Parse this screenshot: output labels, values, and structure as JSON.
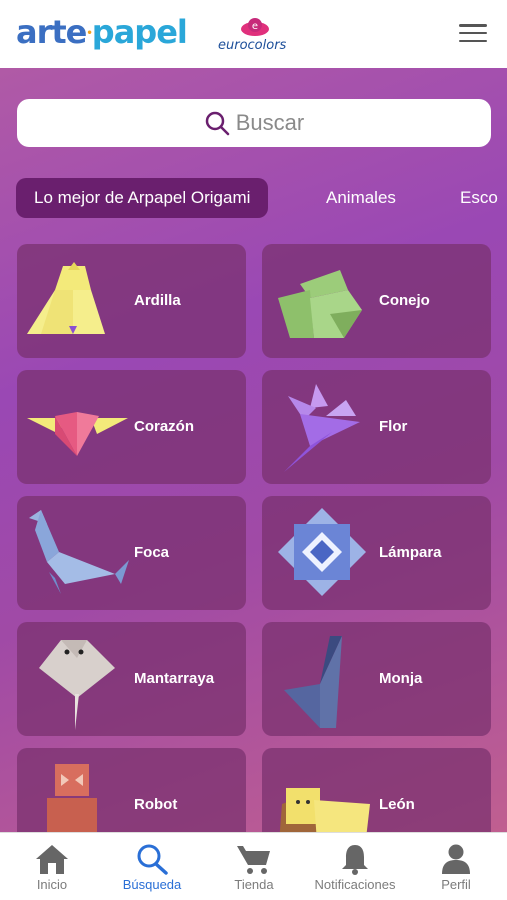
{
  "header": {
    "logo_parts": [
      "arte",
      "papel"
    ],
    "logo_dot": "•",
    "partner_logo": "eurocolors"
  },
  "search": {
    "placeholder": "Buscar"
  },
  "tabs": [
    {
      "label": "Lo mejor de Arpapel Origami",
      "active": true
    },
    {
      "label": "Animales",
      "active": false
    },
    {
      "label": "Esco",
      "active": false
    }
  ],
  "items": [
    {
      "label": "Ardilla"
    },
    {
      "label": "Conejo"
    },
    {
      "label": "Corazón"
    },
    {
      "label": "Flor"
    },
    {
      "label": "Foca"
    },
    {
      "label": "Lámpara"
    },
    {
      "label": "Mantarraya"
    },
    {
      "label": "Monja"
    },
    {
      "label": "Robot"
    },
    {
      "label": "León"
    }
  ],
  "nav": [
    {
      "label": "Inicio",
      "icon": "home-icon",
      "active": false
    },
    {
      "label": "Búsqueda",
      "icon": "search-icon",
      "active": true
    },
    {
      "label": "Tienda",
      "icon": "cart-icon",
      "active": false
    },
    {
      "label": "Notificaciones",
      "icon": "bell-icon",
      "active": false
    },
    {
      "label": "Perfil",
      "icon": "user-icon",
      "active": false
    }
  ],
  "colors": {
    "accent": "#6a1f6e",
    "nav_active": "#2a6fd6"
  }
}
